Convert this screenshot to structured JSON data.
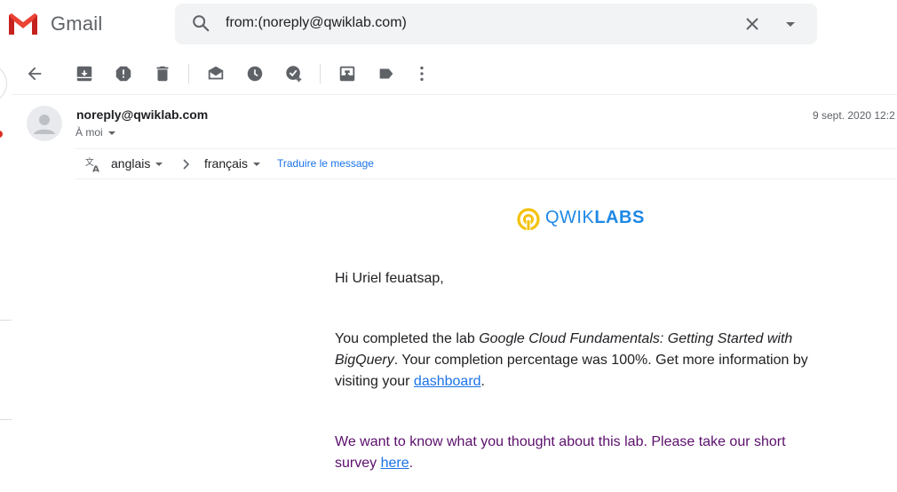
{
  "app": {
    "name": "Gmail"
  },
  "search": {
    "query": "from:(noreply@qwiklab.com)"
  },
  "toolbar": {
    "icons": [
      "back-arrow-icon",
      "archive-icon",
      "report-spam-icon",
      "delete-icon",
      "mark-unread-icon",
      "snooze-icon",
      "add-to-tasks-icon",
      "move-to-icon",
      "label-icon",
      "more-vert-icon"
    ]
  },
  "message": {
    "sender": "noreply@qwiklab.com",
    "recipient": "À moi",
    "date": "9 sept. 2020 12:2"
  },
  "translate": {
    "from_lang": "anglais",
    "to_lang": "français",
    "link": "Traduire le message"
  },
  "body": {
    "brand_light": "QWIK",
    "brand_bold": "LABS",
    "greeting": "Hi Uriel feuatsap,",
    "completion_prefix": "You completed the lab ",
    "lab_name": "Google Cloud Fundamentals: Getting Started with BigQuery",
    "completion_suffix": ". Your completion percentage was 100%. Get more information by visiting your ",
    "dashboard_link": "dashboard",
    "completion_end": ".",
    "survey_prefix": "We want to know what you thought about this lab. Please take our short survey ",
    "survey_link": "here",
    "survey_end": "."
  },
  "colors": {
    "accent": "#1a73e8",
    "brand_blue": "#1e88e5",
    "brand_yellow": "#f4c20d",
    "survey_text": "#5b0f6b",
    "gmail_red": "#ea4335"
  }
}
